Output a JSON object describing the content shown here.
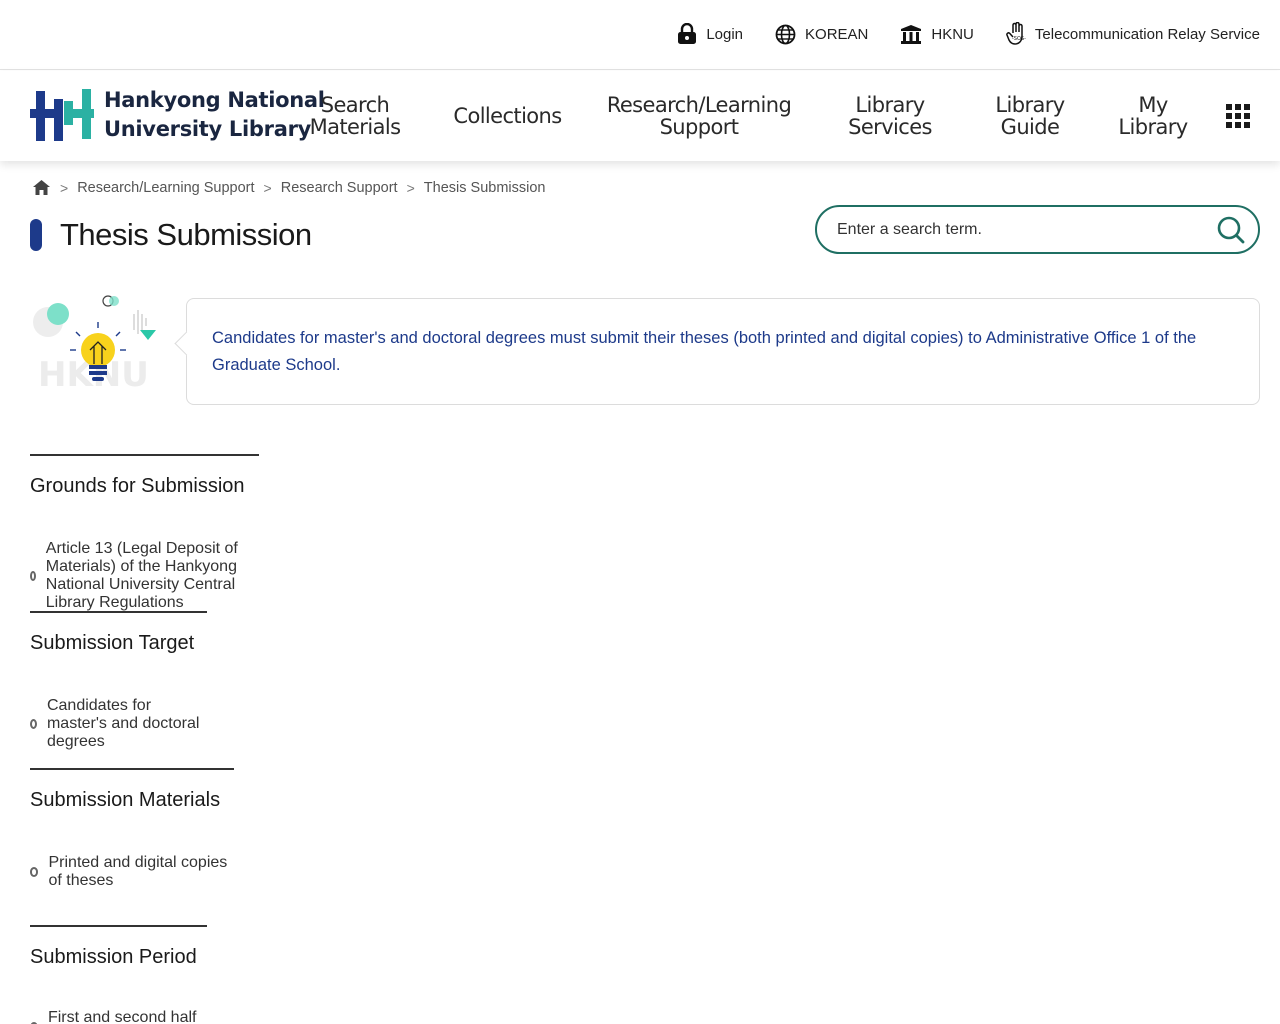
{
  "utility": {
    "login": "Login",
    "korean": "KOREAN",
    "hknu": "HKNU",
    "relay": "Telecommunication Relay Service"
  },
  "logo": {
    "line1": "Hankyong National",
    "line2": "University Library"
  },
  "nav": {
    "search_materials": [
      "Search",
      "Materials"
    ],
    "collections": "Collections",
    "research_support": [
      "Research/Learning",
      "Support"
    ],
    "library_services": [
      "Library",
      "Services"
    ],
    "library_guide": [
      "Library",
      "Guide"
    ],
    "my_library": [
      "My",
      "Library"
    ]
  },
  "breadcrumb": [
    "Research/Learning Support",
    "Research Support",
    "Thesis Submission"
  ],
  "page_title": "Thesis Submission",
  "search": {
    "placeholder": "Enter a search term."
  },
  "intro": {
    "text": "Candidates for master's and doctoral degrees must submit their theses (both printed and digital copies) to Administrative Office 1 of the Graduate School.",
    "illustration_text": "HKNU"
  },
  "sections": [
    {
      "title": "Grounds for Submission",
      "item": "Article 13 (Legal Deposit of Materials) of the Hankyong National University Central Library Regulations"
    },
    {
      "title": "Submission Target",
      "item": "Candidates for master's and doctoral degrees"
    },
    {
      "title": "Submission Materials",
      "item": "Printed and digital copies of theses"
    },
    {
      "title": "Submission Period",
      "item": "First and second half of each year"
    }
  ],
  "colors": {
    "brand_navy": "#1d3a8a",
    "search_border": "#1f6f63",
    "logo_teal": "#2bb1a3",
    "logo_navy": "#1d3a8a"
  }
}
